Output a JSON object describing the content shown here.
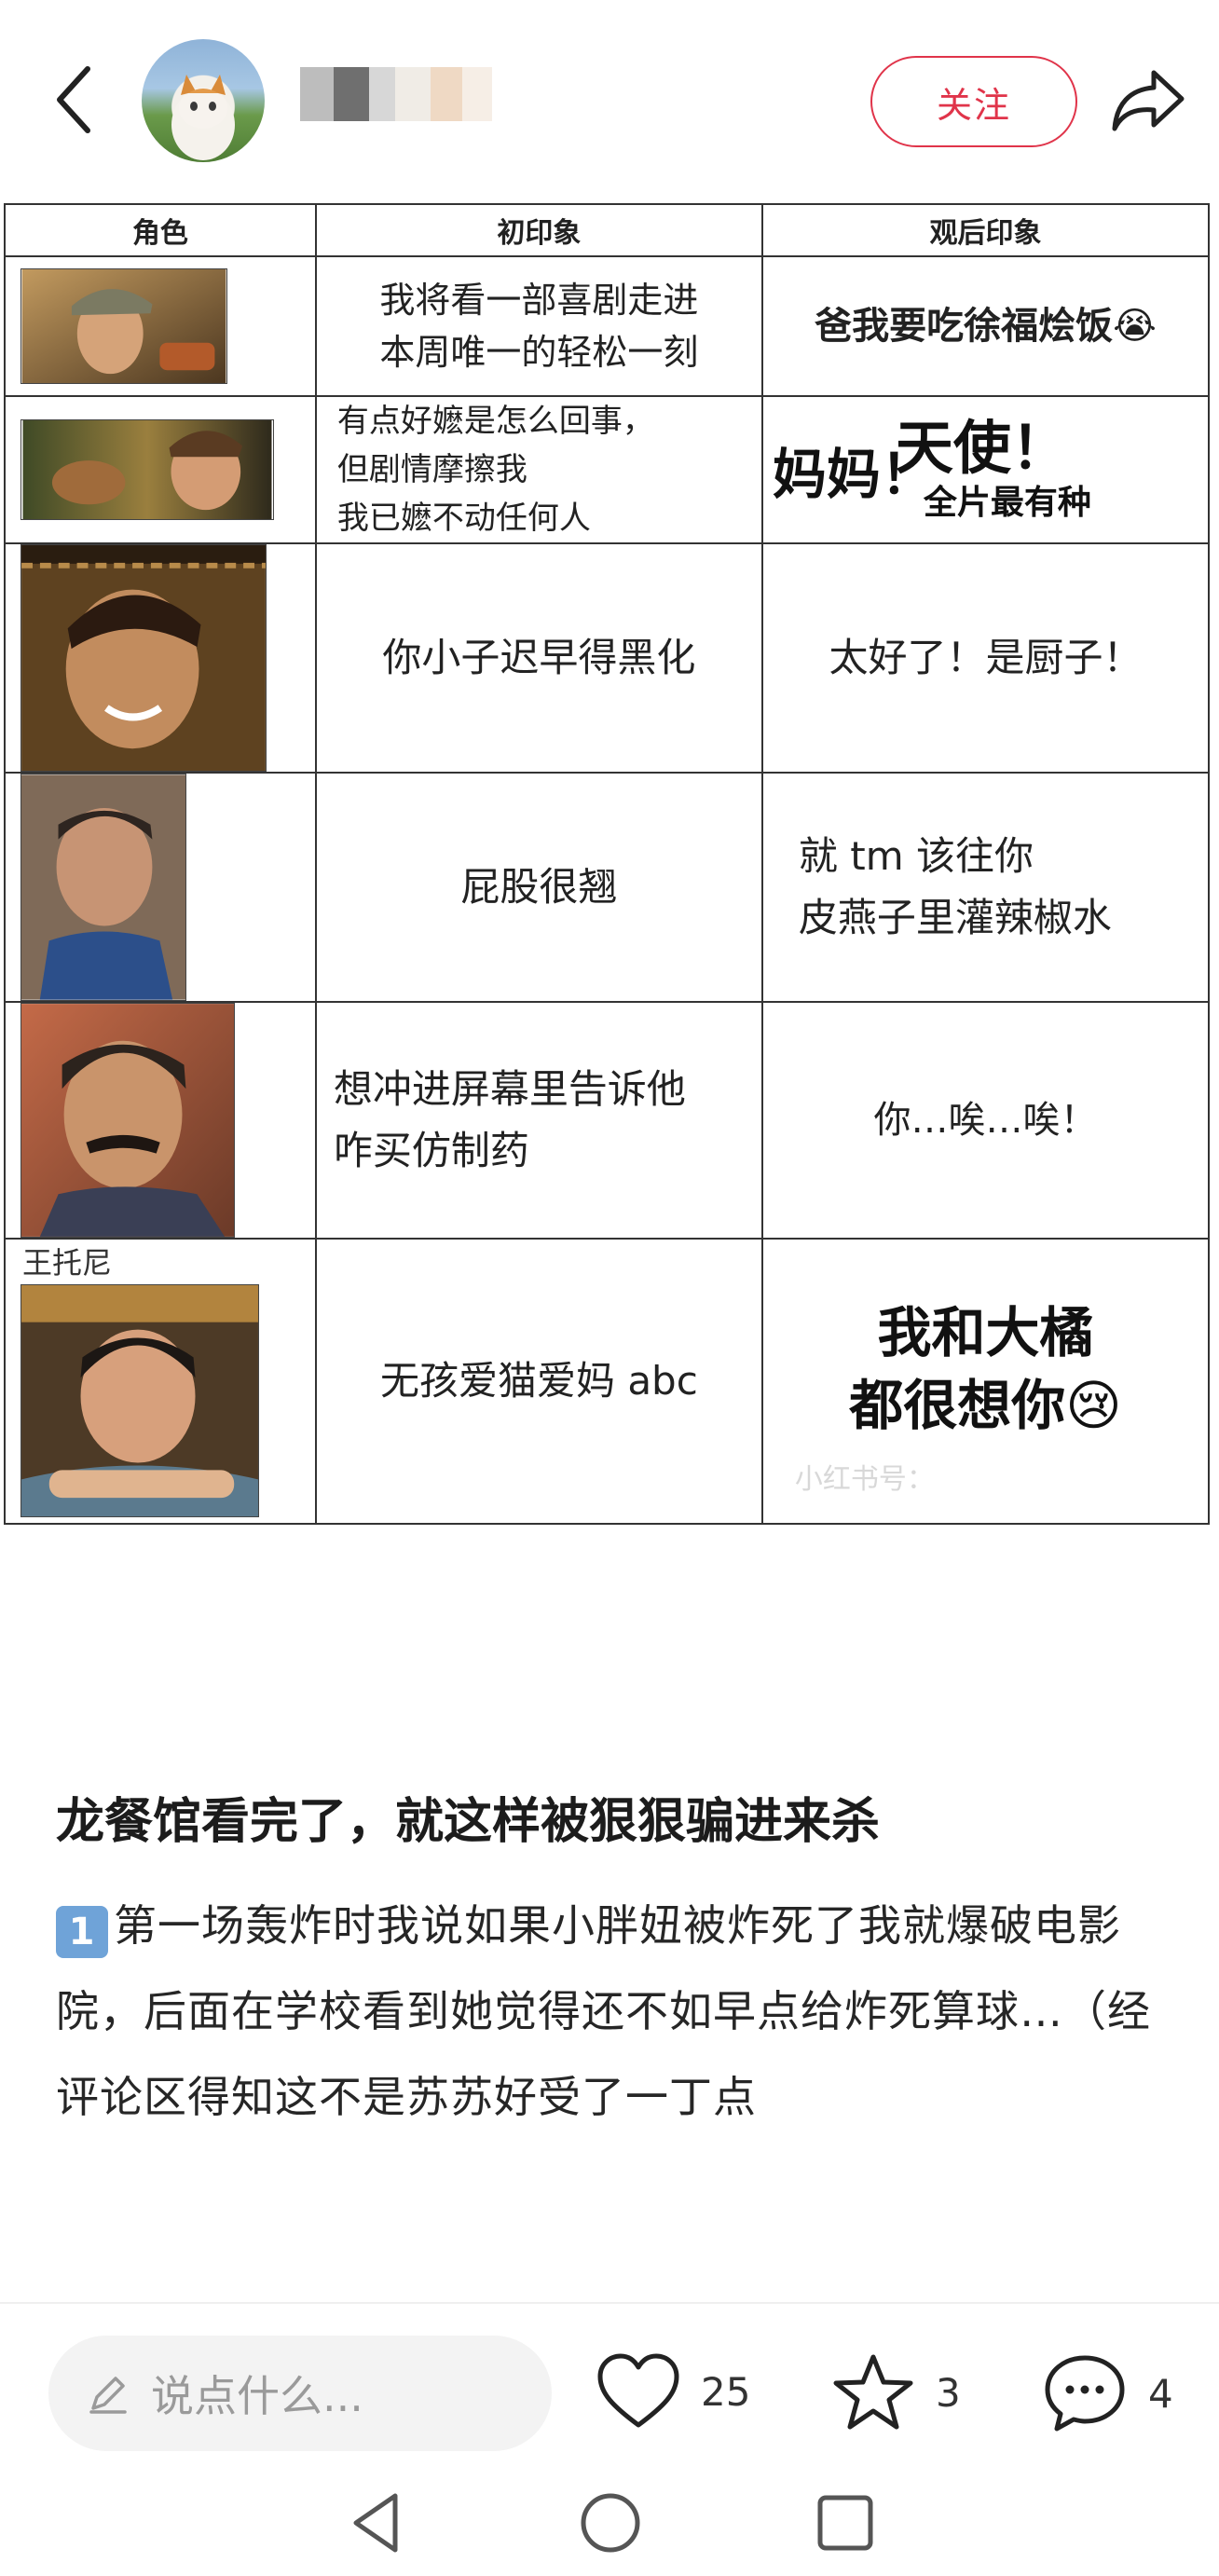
{
  "header": {
    "follow_label": "关注"
  },
  "table": {
    "headers": [
      "角色",
      "初印象",
      "观后印象"
    ],
    "rows": [
      {
        "first": [
          "我将看一部喜剧走进",
          "本周唯一的轻松一刻"
        ],
        "after": "爸我要吃徐福烩饭😭"
      },
      {
        "first": [
          "有点好嬷是怎么回事，",
          "但剧情摩擦我",
          "我已嬷不动任何人"
        ],
        "after_big1": "天使！",
        "after_big2": "妈妈！",
        "after_small": "全片最有种"
      },
      {
        "first": [
          "你小子迟早得黑化"
        ],
        "after": "太好了！是厨子！"
      },
      {
        "first": [
          "屁股很翘"
        ],
        "after_lines": [
          "就 tm 该往你",
          "皮燕子里灌辣椒水"
        ]
      },
      {
        "first": [
          "想冲进屏幕里告诉他",
          "咋买仿制药"
        ],
        "after": "你…唉…唉！"
      },
      {
        "name": "王托尼",
        "first": [
          "无孩爱猫爱妈 abc"
        ],
        "after_lines": [
          "我和大橘",
          "都很想你😢"
        ],
        "watermark": "小红书号："
      }
    ]
  },
  "post": {
    "title": "龙餐馆看完了，就这样被狠狠骗进来杀",
    "badge": "1",
    "body": "第一场轰炸时我说如果小胖妞被炸死了我就爆破电影院，后面在学校看到她觉得还不如早点给炸死算球…（经评论区得知这不是苏苏好受了一丁点"
  },
  "bottom_bar": {
    "comment_placeholder": "说点什么...",
    "likes": "25",
    "favorites": "3",
    "comments": "4"
  },
  "colors": {
    "follow": "#e0344a",
    "badge": "#6fa3d8"
  }
}
